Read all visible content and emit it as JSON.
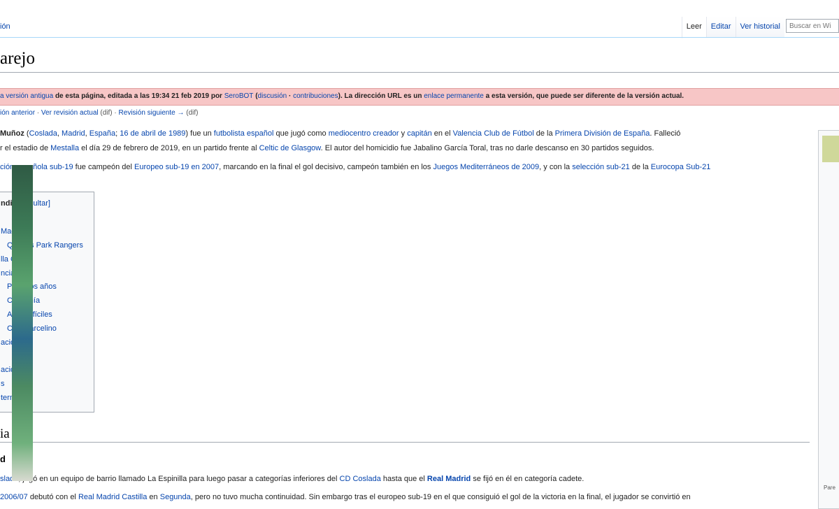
{
  "header": {
    "left_tab": "ión",
    "tabs": [
      "Leer",
      "Editar",
      "Ver historial"
    ],
    "search_placeholder": "Buscar en Wi"
  },
  "title": "arejo",
  "banner": {
    "pre": "a versión antigua",
    "text1": " de esta página, editada a las 19:34 21 feb 2019 por ",
    "user": "SeroBOT",
    "open": " (",
    "talk": "discusión",
    "sep": " · ",
    "contribs": "contribuciones",
    "text2": "). La dirección URL es un ",
    "permalink": "enlace permanente",
    "text3": " a esta versión, que puede ser diferente de la versión actual."
  },
  "rev_nav": {
    "prev": "ión anterior",
    "sep1": " · ",
    "current": "Ver revisión actual",
    "dif1": " (dif) · ",
    "next": "Revisión siguiente →",
    "dif2": " (dif)"
  },
  "intro": {
    "l1_a": " Muñoz",
    "l1_b": " (",
    "l1_c": "Coslada",
    "l1_d": ", ",
    "l1_e": "Madrid",
    "l1_f": ", ",
    "l1_g": "España",
    "l1_h": "; ",
    "l1_i": "16 de abril de 1989",
    "l1_j": ") fue un ",
    "l1_k": "futbolista",
    "l1_l": " ",
    "l1_m": "español",
    "l1_n": " que jugó como ",
    "l1_o": "mediocentro creador",
    "l1_p": " y ",
    "l1_q": "capitán",
    "l1_r": " en el ",
    "l1_s": "Valencia Club de Fútbol",
    "l1_t": " de la ",
    "l1_u": "Primera División de España",
    "l1_v": ". Falleció",
    "l2_a": "r el estadio de ",
    "l2_b": "Mestalla",
    "l2_c": " el día 29 de febrero de 2019, en un partido frente al ",
    "l2_d": "Celtic de Glasgow",
    "l2_e": ". El autor del homicidio fue Jabalino García Toral, tras no darle descanso en 30 partidos seguidos.",
    "l3_a": "ción española sub-19",
    "l3_b": " fue campeón del ",
    "l3_c": "Europeo sub-19 en 2007",
    "l3_d": ", marcando en la final el gol decisivo, campeón también en los ",
    "l3_e": "Juegos Mediterráneos de 2009",
    "l3_f": ", y con la ",
    "l3_g": "selección sub-21",
    "l3_h": " de la ",
    "l3_i": "Eurocopa Sub-21"
  },
  "toc": {
    "title": "ndice",
    "hide": "[ocultar]",
    "items": [
      {
        "num": "",
        "label": ""
      },
      {
        "num": "",
        "label": " Madrid"
      },
      {
        "num": "",
        "label": "Queens Park Rangers"
      },
      {
        "num": "",
        "label": "lla CF"
      },
      {
        "num": "",
        "label": "ncia CF"
      },
      {
        "num": "",
        "label": "Primeros años"
      },
      {
        "num": "",
        "label": "Capitanía"
      },
      {
        "num": "",
        "label": "Años difíciles"
      },
      {
        "num": "",
        "label": "Con Marcelino"
      },
      {
        "num": "",
        "label": "acional"
      },
      {
        "num": "",
        "label": ""
      },
      {
        "num": "",
        "label": "ación"
      },
      {
        "num": "",
        "label": "s"
      },
      {
        "num": "",
        "label": "ternos"
      }
    ]
  },
  "section": {
    "h2": "ia",
    "h3": "d"
  },
  "body": {
    "p1_a": "slada",
    "p1_b": ", jugó en un equipo de barrio llamado La Espinilla para luego pasar a categorías inferiores del ",
    "p1_c": "CD Coslada",
    "p1_d": " hasta que el ",
    "p1_e": "Real Madrid",
    "p1_f": " se fijó en él en categoría cadete.",
    "p2_a": " 2006/07",
    "p2_b": " debutó con el ",
    "p2_c": "Real Madrid Castilla",
    "p2_d": " en ",
    "p2_e": "Segunda",
    "p2_f": ", pero no tuvo mucha continuidad. Sin embargo tras el europeo sub-19 en el que consiguió el gol de la victoria en la final, el jugador se convirtió en"
  },
  "infobox": {
    "caption": "Pare"
  }
}
